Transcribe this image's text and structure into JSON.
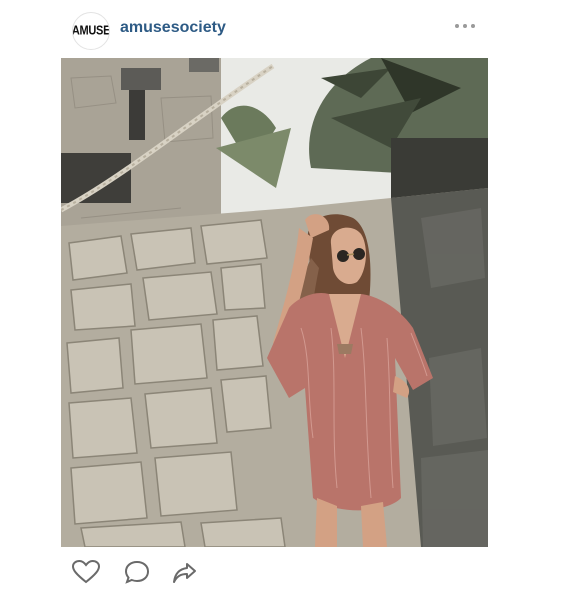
{
  "post": {
    "avatar_text": "AMUSE",
    "username": "amusesociety",
    "image_alt": "Woman in sunglasses and a pink patterned romper posing against an old stone wall with palm trees"
  },
  "actions": {
    "like_icon": "heart-icon",
    "comment_icon": "comment-icon",
    "share_icon": "share-icon"
  }
}
